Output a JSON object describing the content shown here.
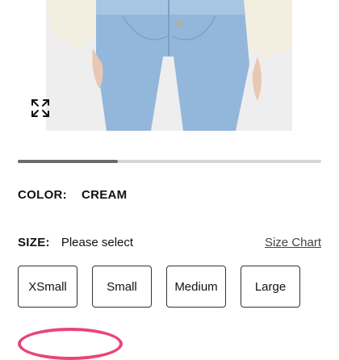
{
  "gallery": {
    "image_alt": "Model wearing light blue wash jeans",
    "expand_icon": "expand-arrows-icon",
    "progress_fraction": 0.33
  },
  "color": {
    "label": "COLOR:",
    "value": "CREAM"
  },
  "size": {
    "label": "SIZE:",
    "prompt": "Please select",
    "chart_link": "Size Chart",
    "options": [
      "XSmall",
      "Small",
      "Medium",
      "Large"
    ]
  },
  "colors": {
    "accent_annotation": "#e8457a",
    "denim": "#8db3d9",
    "progress": "#6b6b6b"
  }
}
